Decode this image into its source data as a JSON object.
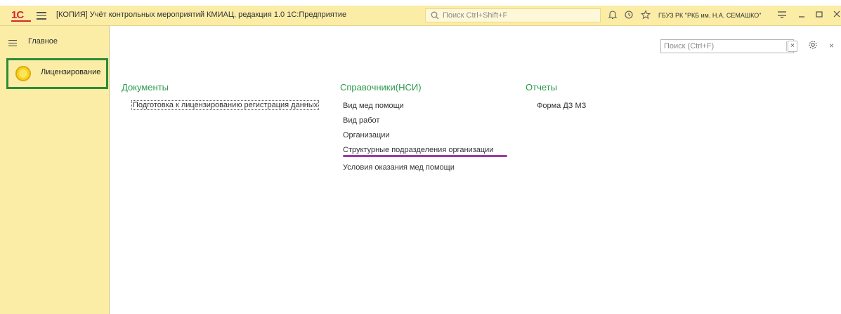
{
  "titlebar": {
    "logo": "1С",
    "title": "[КОПИЯ] Учёт контрольных мероприятий КМИАЦ, редакция 1.0 1С:Предприятие",
    "search_placeholder": "Поиск Ctrl+Shift+F",
    "user": "ГБУЗ РК \"РКБ им. Н.А. СЕМАШКО\"",
    "icons": [
      "bell-icon",
      "history-icon",
      "star-icon",
      "menu-lines-icon",
      "minimize-icon",
      "maximize-icon",
      "close-icon"
    ]
  },
  "sidebar": {
    "items": [
      {
        "label": "Главное",
        "icon": "hamburger-icon"
      },
      {
        "label": "Лицензирование",
        "icon": "yellow-circle-icon",
        "selected": true
      }
    ]
  },
  "content": {
    "search_placeholder": "Поиск (Ctrl+F)",
    "clear_label": "×",
    "close_label": "×",
    "groups": [
      {
        "title": "Документы",
        "links": [
          "Подготовка к лицензированию регистрация данных"
        ]
      },
      {
        "title": "Справочники(НСИ)",
        "links": [
          "Вид мед помощи",
          "Вид работ",
          "Организации",
          "Структурные подразделения организации",
          "Условия оказания мед помощи"
        ]
      },
      {
        "title": "Отчеты",
        "links": [
          "Форма ДЗ МЗ"
        ]
      }
    ]
  },
  "colors": {
    "sidebar_bg": "#fbeca6",
    "group_title": "#2a9a4a",
    "selection_border": "#2e8b34",
    "annotation_underline": "#9b3ca6"
  }
}
